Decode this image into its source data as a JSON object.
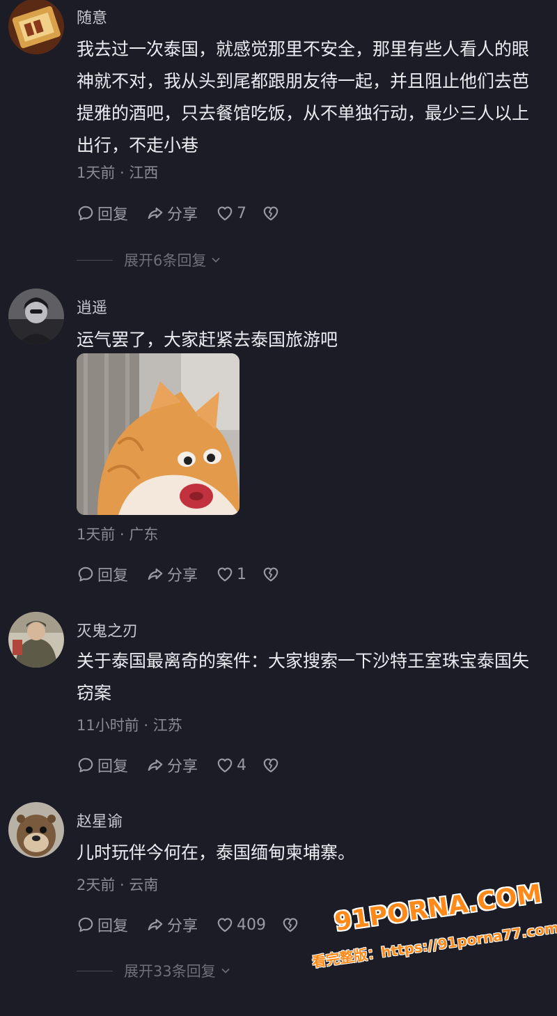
{
  "comments": [
    {
      "username": "随意",
      "text": "我去过一次泰国，就感觉那里不安全，那里有些人看人的眼神就不对，我从头到尾都跟朋友待一起，并且阻止他们去芭提雅的酒吧，只去餐馆吃饭，从不单独行动，最少三人以上出行，不走小巷",
      "meta": "1天前 · 江西",
      "reply_label": "回复",
      "share_label": "分享",
      "likes": "7",
      "expand_label": "展开6条回复"
    },
    {
      "username": "逍遥",
      "text": "运气罢了，大家赶紧去泰国旅游吧",
      "meta": "1天前 · 广东",
      "reply_label": "回复",
      "share_label": "分享",
      "likes": "1"
    },
    {
      "username": "灭鬼之刃",
      "text": "关于泰国最离奇的案件：大家搜索一下沙特王室珠宝泰国失窃案",
      "meta": "11小时前 · 江苏",
      "reply_label": "回复",
      "share_label": "分享",
      "likes": "4"
    },
    {
      "username": "赵星谕",
      "text": "儿时玩伴今何在，泰国缅甸柬埔寨。",
      "meta": "2天前 · 云南",
      "reply_label": "回复",
      "share_label": "分享",
      "likes": "409",
      "expand_label": "展开33条回复"
    }
  ],
  "watermark": {
    "site": "91PORNA.COM",
    "line2": "看完整版：https://91porna77.com"
  },
  "colors": {
    "background": "#1c1c27",
    "text": "#ececf0",
    "muted": "#8a8a95",
    "watermark": "#ff8a1a"
  }
}
